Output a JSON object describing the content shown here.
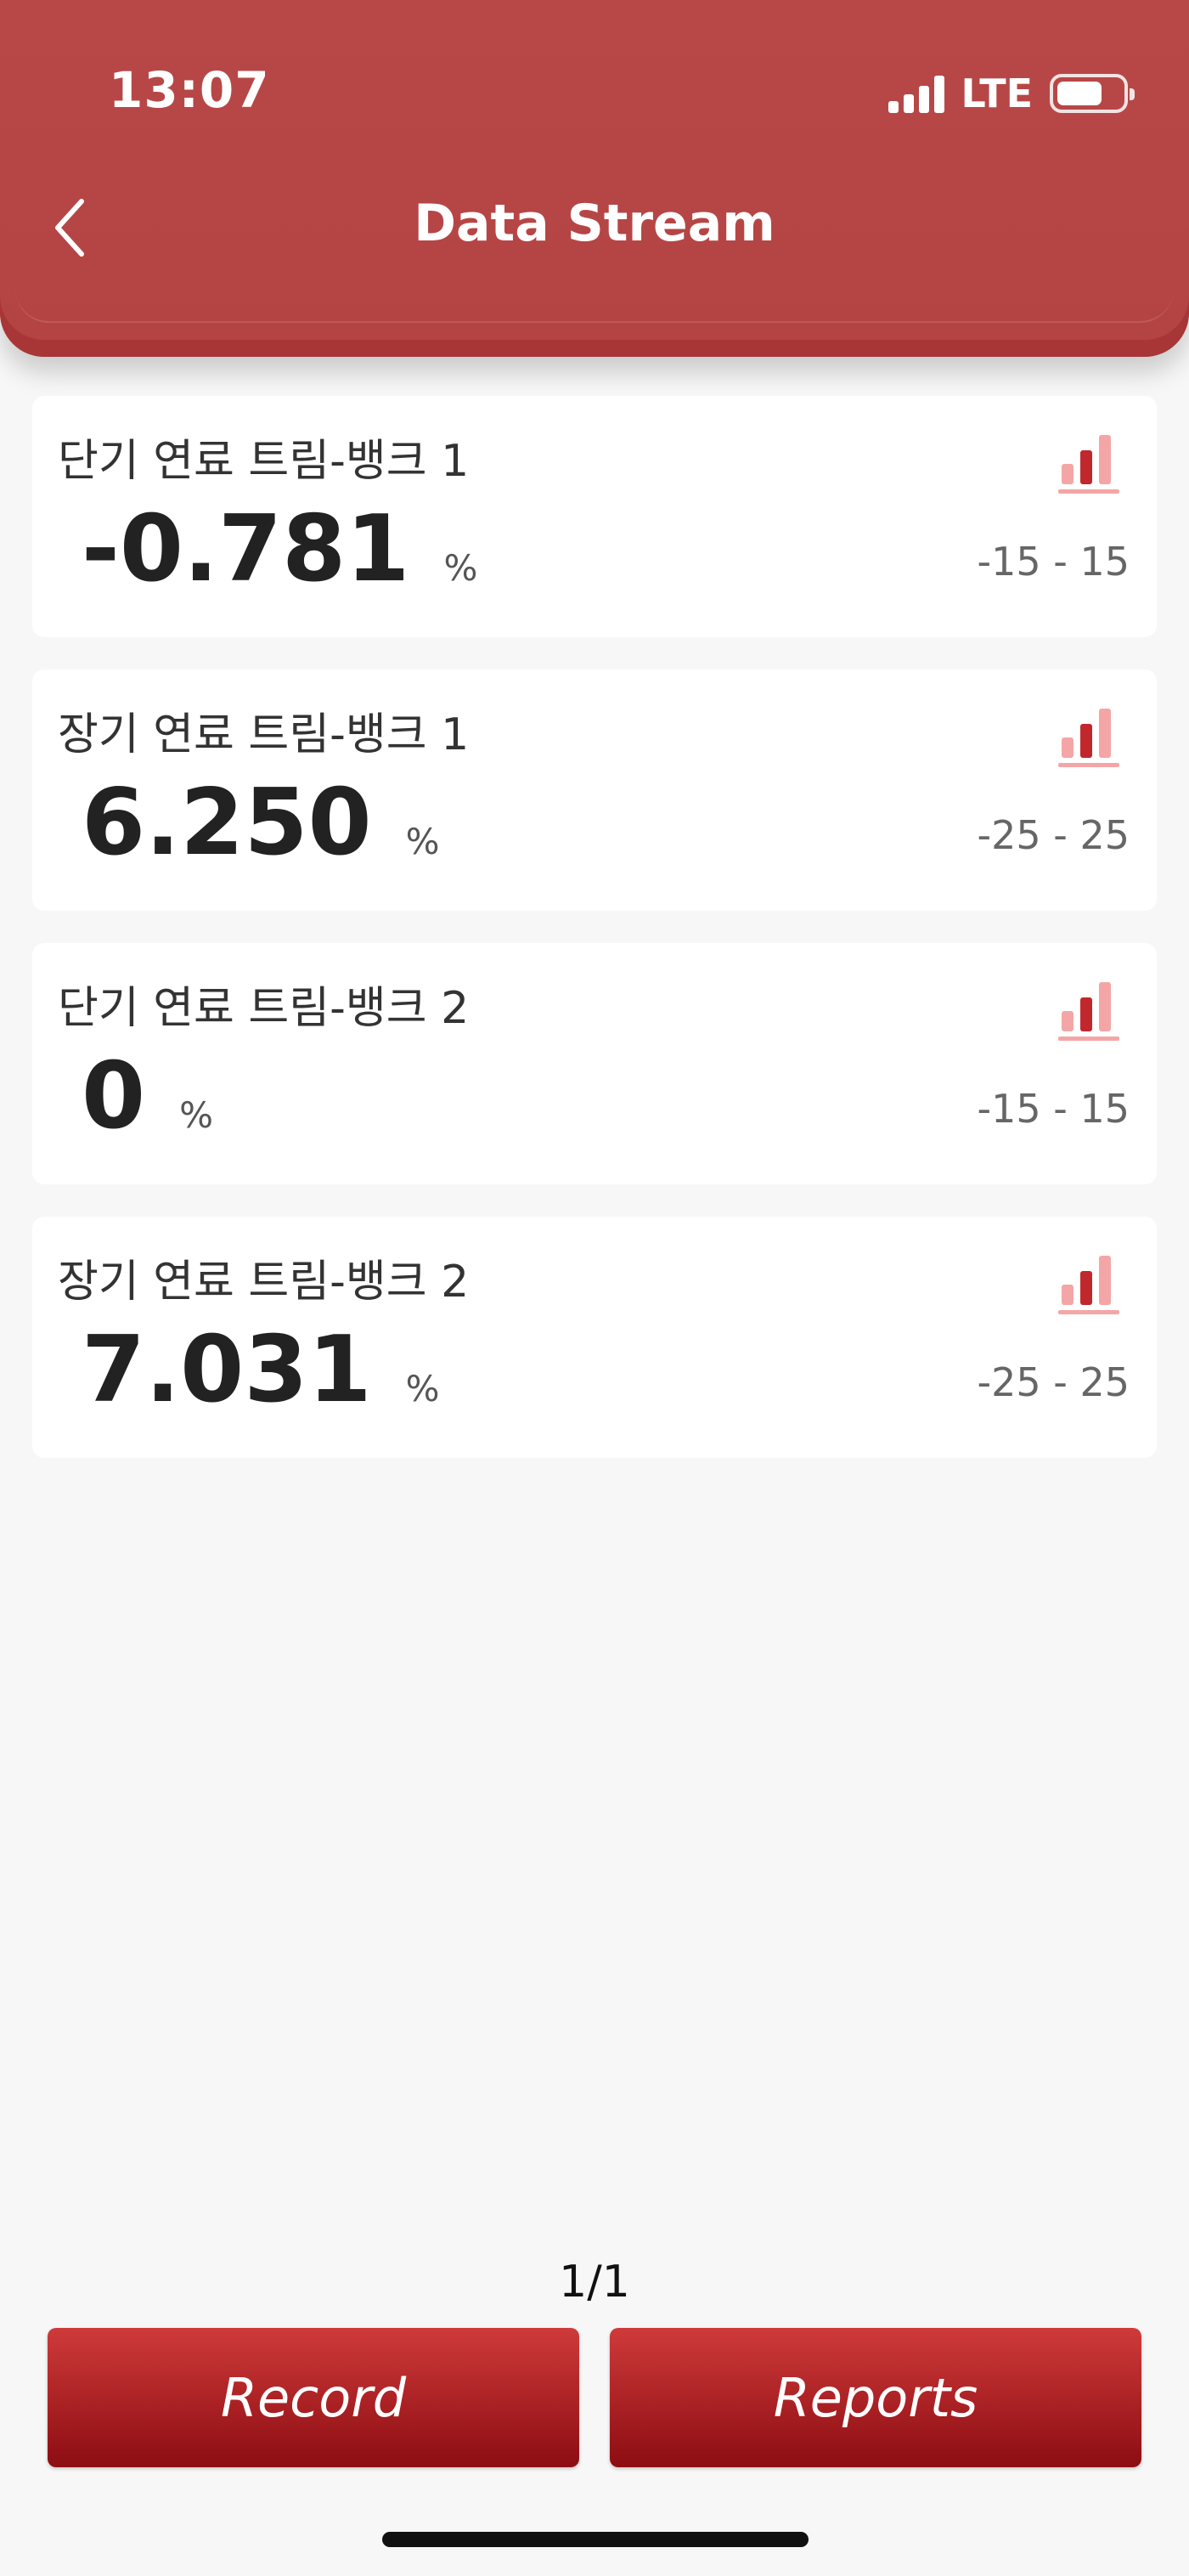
{
  "status": {
    "time": "13:07",
    "network": "LTE"
  },
  "header": {
    "title": "Data Stream"
  },
  "cards": [
    {
      "label": "단기 연료 트림-뱅크 1",
      "value": "-0.781",
      "unit": "%",
      "range": "-15 - 15"
    },
    {
      "label": "장기 연료 트림-뱅크 1",
      "value": "6.250",
      "unit": "%",
      "range": "-25 - 25"
    },
    {
      "label": "단기 연료 트림-뱅크 2",
      "value": "0",
      "unit": "%",
      "range": "-15 - 15"
    },
    {
      "label": "장기 연료 트림-뱅크 2",
      "value": "7.031",
      "unit": "%",
      "range": "-25 - 25"
    }
  ],
  "pager": "1/1",
  "buttons": {
    "record": "Record",
    "reports": "Reports"
  },
  "colors": {
    "header": "#b84848",
    "accent": "#c0282d",
    "accent_light": "#f4a6a6"
  }
}
